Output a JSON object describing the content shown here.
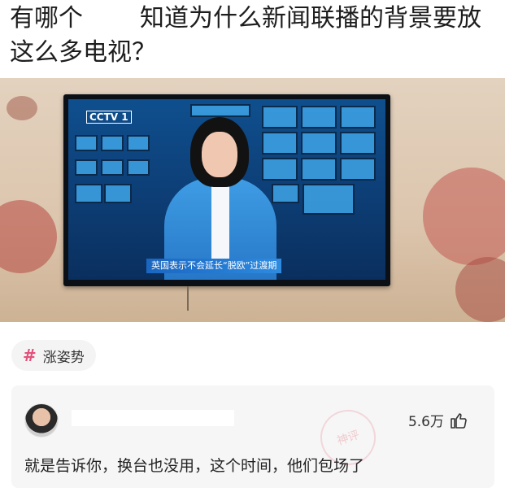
{
  "post": {
    "title_part1": "有哪个",
    "title_part2": "知道为什么新闻联播的背景要放这么多电视？"
  },
  "photo": {
    "tv_logo": "CCTV 1",
    "ticker_text": "英国表示不会延长“脱欧”过渡期"
  },
  "topic_tag": {
    "icon": "hash-icon",
    "label": "涨姿势",
    "icon_color": "#e4507a"
  },
  "comment": {
    "like_count": "5.6万",
    "like_icon": "thumbs-up-icon",
    "text": "就是告诉你，换台也没用，这个时间，他们包场了",
    "stamp_text": "神评"
  }
}
